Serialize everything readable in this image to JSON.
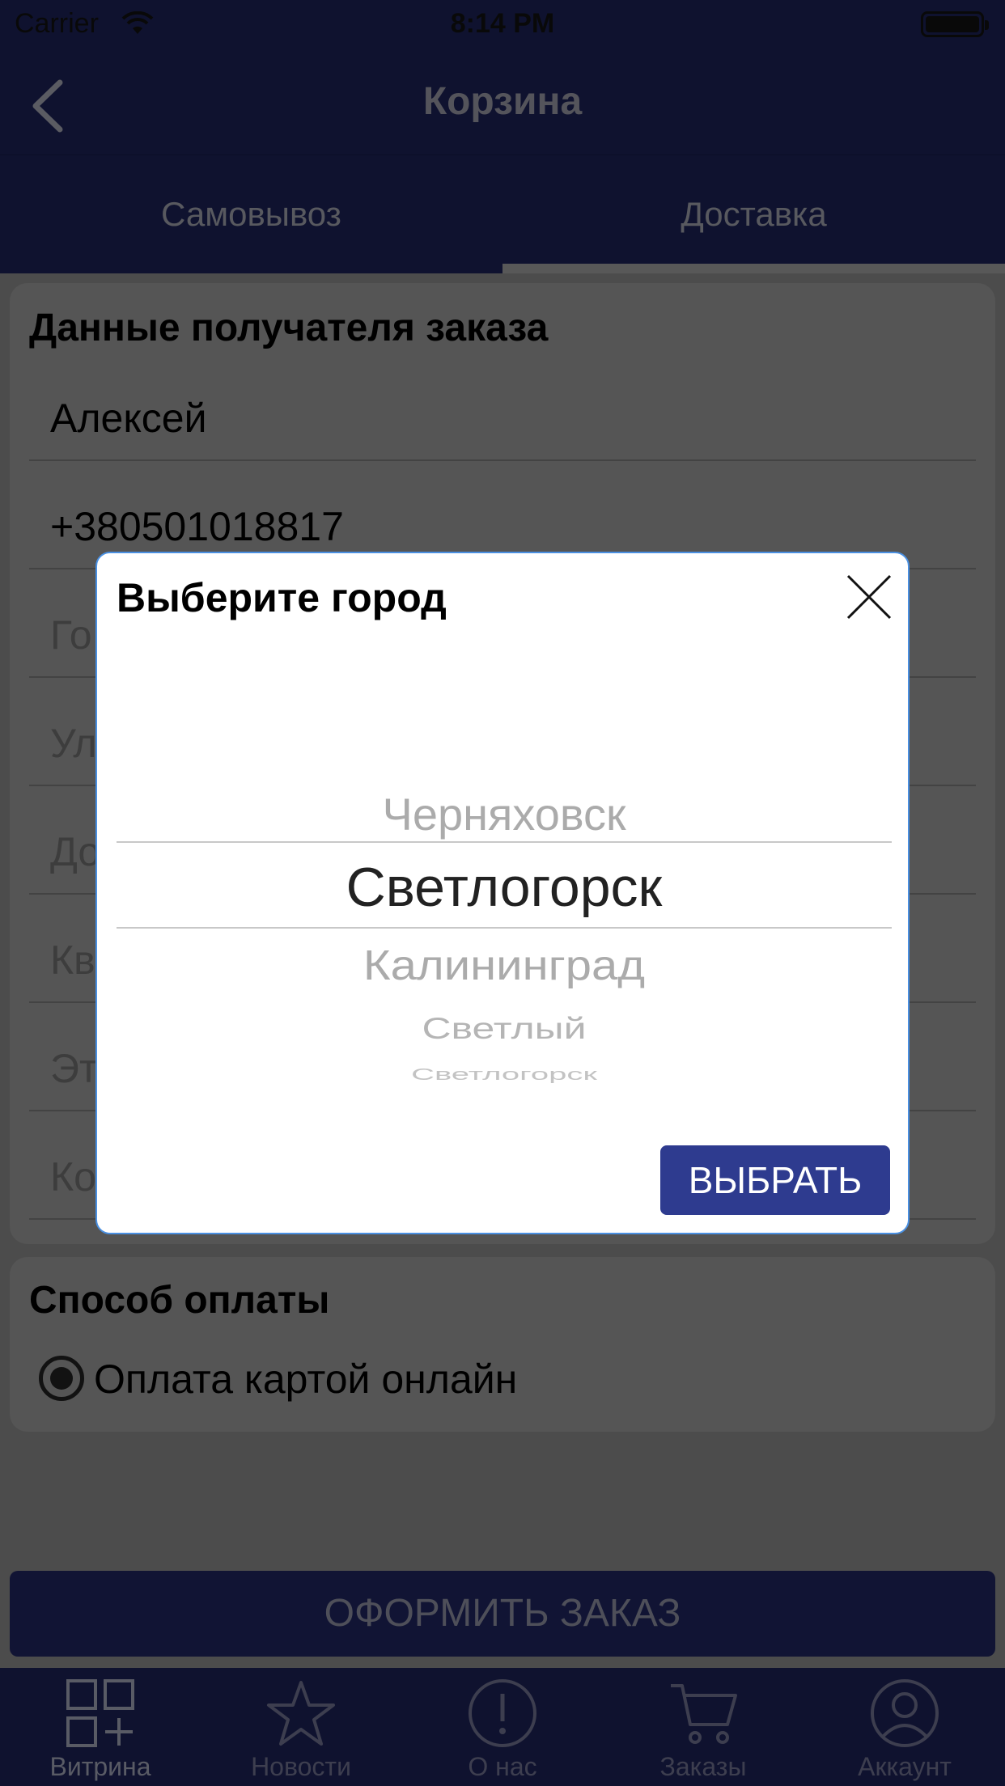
{
  "status_bar": {
    "carrier": "Carrier",
    "time": "8:14 PM"
  },
  "nav": {
    "title": "Корзина"
  },
  "tabs": [
    {
      "label": "Самовывоз",
      "active": false
    },
    {
      "label": "Доставка",
      "active": true
    }
  ],
  "recipient": {
    "title": "Данные получателя заказа",
    "name_value": "Алексей",
    "phone_value": "+380501018817",
    "city_placeholder": "Го",
    "street_placeholder": "Ул",
    "house_placeholder": "До",
    "apartment_placeholder": "Кв",
    "floor_placeholder": "Эт",
    "comment_placeholder": "Ко"
  },
  "payment": {
    "title": "Способ оплаты",
    "option_label": "Оплата картой онлайн",
    "selected": true
  },
  "submit_label": "ОФОРМИТЬ ЗАКАЗ",
  "bottom_tabs": [
    {
      "label": "Витрина",
      "icon": "grid-plus-icon",
      "active": true
    },
    {
      "label": "Новости",
      "icon": "star-icon",
      "active": false
    },
    {
      "label": "О нас",
      "icon": "info-exclamation-icon",
      "active": false
    },
    {
      "label": "Заказы",
      "icon": "cart-icon",
      "active": false
    },
    {
      "label": "Аккаунт",
      "icon": "user-icon",
      "active": false
    }
  ],
  "city_modal": {
    "title": "Выберите город",
    "options": [
      "Черняховск",
      "Светлогорск",
      "Калининград",
      "Светлый",
      "Светлогорск"
    ],
    "selected": "Светлогорск",
    "choose_label": "ВЫБРАТЬ"
  },
  "colors": {
    "primary_dark": "#1d2257",
    "button_primary": "#2e3b8f",
    "modal_border": "#4a90e2"
  }
}
